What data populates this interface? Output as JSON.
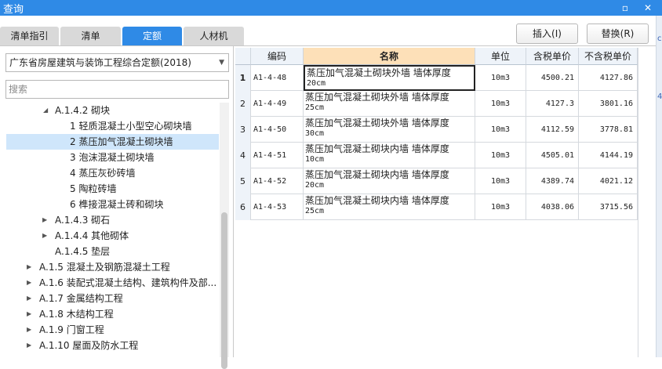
{
  "window": {
    "title": "查询",
    "minimize": "▫",
    "close": "✕"
  },
  "right_strip": {
    "chars": [
      "c",
      "4"
    ]
  },
  "tabs": [
    {
      "label": "清单指引",
      "active": false
    },
    {
      "label": "清单",
      "active": false
    },
    {
      "label": "定额",
      "active": true
    },
    {
      "label": "人材机",
      "active": false
    }
  ],
  "actions": {
    "insert_label": "插入(I)",
    "replace_label": "替换(R)"
  },
  "library": {
    "selected": "广东省房屋建筑与装饰工程综合定额(2018)"
  },
  "search": {
    "placeholder": "搜索"
  },
  "tree": [
    {
      "label": "A.1.4.2 砌块",
      "toggle": "◢",
      "expanded": true,
      "selected": false
    },
    {
      "label": "1 轻质混凝土小型空心砌块墙",
      "toggle": "",
      "selected": false
    },
    {
      "label": "2 蒸压加气混凝土砌块墙",
      "toggle": "",
      "selected": true
    },
    {
      "label": "3 泡沫混凝土砌块墙",
      "toggle": "",
      "selected": false
    },
    {
      "label": "4 蒸压灰砂砖墙",
      "toggle": "",
      "selected": false
    },
    {
      "label": "5 陶粒砖墙",
      "toggle": "",
      "selected": false
    },
    {
      "label": "6 榫接混凝土砖和砌块",
      "toggle": "",
      "selected": false
    },
    {
      "label": "A.1.4.3 砌石",
      "toggle": "▶",
      "selected": false
    },
    {
      "label": "A.1.4.4 其他砌体",
      "toggle": "▶",
      "selected": false
    },
    {
      "label": "A.1.4.5 垫层",
      "toggle": "",
      "selected": false
    },
    {
      "label": "A.1.5 混凝土及钢筋混凝土工程",
      "toggle": "▶",
      "selected": false
    },
    {
      "label": "A.1.6 装配式混凝土结构、建筑构件及部...",
      "toggle": "▶",
      "selected": false
    },
    {
      "label": "A.1.7 金属结构工程",
      "toggle": "▶",
      "selected": false
    },
    {
      "label": "A.1.8 木结构工程",
      "toggle": "▶",
      "selected": false
    },
    {
      "label": "A.1.9 门窗工程",
      "toggle": "▶",
      "selected": false
    },
    {
      "label": "A.1.10 屋面及防水工程",
      "toggle": "▶",
      "selected": false
    }
  ],
  "table": {
    "headers": [
      "",
      "编码",
      "名称",
      "单位",
      "含税单价",
      "不含税单价"
    ],
    "rows": [
      {
        "idx": "1",
        "code": "A1-4-48",
        "name": "蒸压加气混凝土砌块外墙 墙体厚度",
        "name2": "20cm",
        "unit": "10m3",
        "price_tax": "4500.21",
        "price_notax": "4127.86"
      },
      {
        "idx": "2",
        "code": "A1-4-49",
        "name": "蒸压加气混凝土砌块外墙 墙体厚度",
        "name2": "25cm",
        "unit": "10m3",
        "price_tax": "4127.3",
        "price_notax": "3801.16"
      },
      {
        "idx": "3",
        "code": "A1-4-50",
        "name": "蒸压加气混凝土砌块外墙 墙体厚度",
        "name2": "30cm",
        "unit": "10m3",
        "price_tax": "4112.59",
        "price_notax": "3778.81"
      },
      {
        "idx": "4",
        "code": "A1-4-51",
        "name": "蒸压加气混凝土砌块内墙 墙体厚度",
        "name2": "10cm",
        "unit": "10m3",
        "price_tax": "4505.01",
        "price_notax": "4144.19"
      },
      {
        "idx": "5",
        "code": "A1-4-52",
        "name": "蒸压加气混凝土砌块内墙 墙体厚度",
        "name2": "20cm",
        "unit": "10m3",
        "price_tax": "4389.74",
        "price_notax": "4021.12"
      },
      {
        "idx": "6",
        "code": "A1-4-53",
        "name": "蒸压加气混凝土砌块内墙 墙体厚度",
        "name2": "25cm",
        "unit": "10m3",
        "price_tax": "4038.06",
        "price_notax": "3715.56"
      }
    ]
  },
  "colors": {
    "accent": "#2f8ae6",
    "selection": "#cfe6fb",
    "header_highlight": "#fde0b8"
  }
}
